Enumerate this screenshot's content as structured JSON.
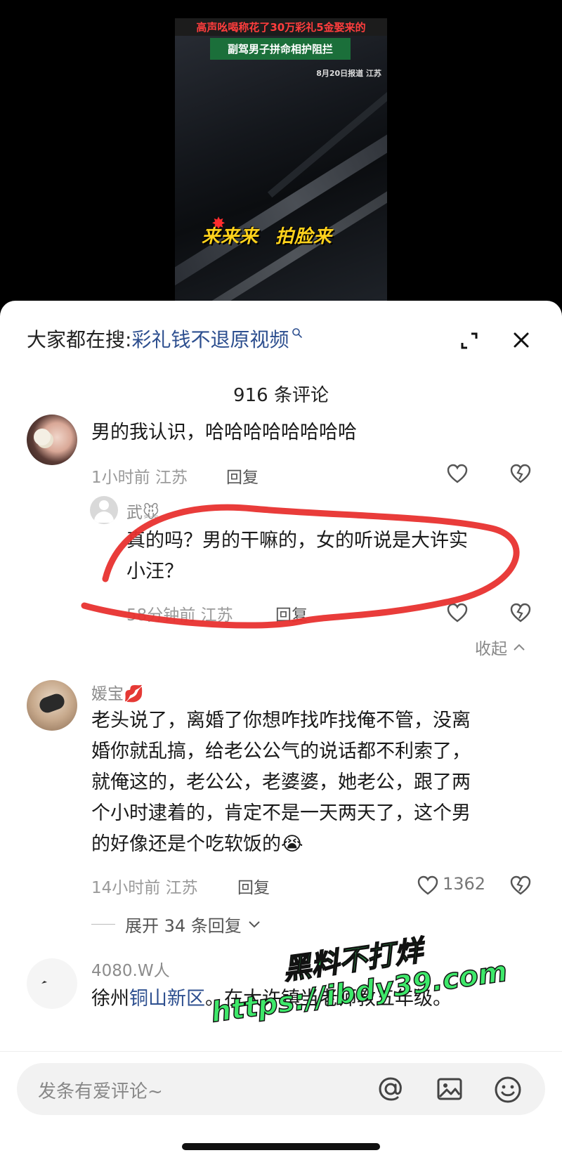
{
  "video": {
    "caption_top": "高声吆喝称花了30万彩礼5金娶来的",
    "caption_green": "副驾男子拼命相护阻拦",
    "caption_date": "8月20日报道 江苏",
    "caption_big_left": "来来来",
    "caption_big_right": "拍脸来"
  },
  "header": {
    "search_prefix": "大家都在搜:",
    "search_term": "彩礼钱不退原视频",
    "comment_count": "916 条评论"
  },
  "comments": [
    {
      "name": "",
      "text": "男的我认识，哈哈哈哈哈哈哈哈",
      "time_location": "1小时前 江苏",
      "reply_label": "回复"
    },
    {
      "name": "武🐭",
      "text_line1": "真的吗？男的干嘛的，女的听说是大许实",
      "text_line2": "小汪？",
      "time_location": "58分钟前 江苏",
      "reply_label": "回复",
      "collapse_label": "收起"
    },
    {
      "name": "媛宝💋",
      "text_lines": [
        "老头说了，离婚了你想咋找咋找俺不管，没离",
        "婚你就乱搞，给老公公气的说话都不利索了，",
        "就俺这的，老公公，老婆婆，她老公，跟了两",
        "个小时逮着的，肯定不是一天两天了，这个男",
        "的好像还是个吃软饭的😭"
      ],
      "time_location": "14小时前 江苏",
      "reply_label": "回复",
      "like_count": "1362",
      "expand_replies": "展开 34 条回复"
    },
    {
      "name": "4080.W人",
      "text_before": "徐州",
      "text_link": "铜山新区",
      "text_after": "。在大许镇当老师教五年级。"
    }
  ],
  "bottom": {
    "placeholder": "发条有爱评论~"
  },
  "watermark": {
    "line1": "黑料不打烊",
    "line2": "https://ibdy39.com"
  },
  "colors": {
    "link": "#2d4f8f",
    "annotation_red": "#e8322f",
    "watermark_green": "#3ee86a"
  }
}
